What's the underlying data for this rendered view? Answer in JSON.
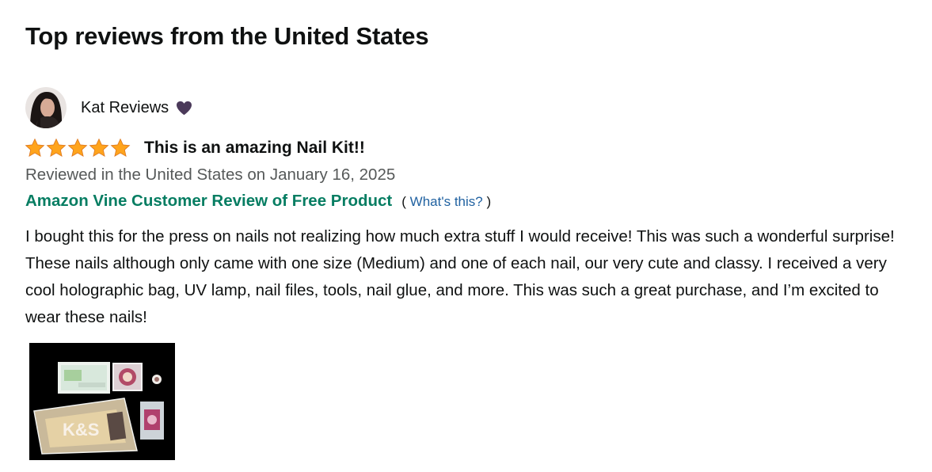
{
  "section": {
    "title": "Top reviews from the United States"
  },
  "review": {
    "profile_name": "Kat Reviews",
    "badge_icon": "purple-heart-icon",
    "rating": {
      "value": 5,
      "max": 5,
      "color": "#ffa41c"
    },
    "title": "This is an amazing Nail Kit!!",
    "date": "Reviewed in the United States on January 16, 2025",
    "vine": {
      "label": "Amazon Vine Customer Review of Free Product",
      "open_paren": "(",
      "link": "What's this?",
      "close_paren": ")",
      "color": "#067d62"
    },
    "body": "I bought this for the press on nails not realizing how much extra stuff I would receive! This was such a wonderful surprise! These nails although only came with one size (Medium) and one of each nail, our very cute and classy. I received a very cool holographic bag, UV lamp, nail files, tools, nail glue, and more. This was such a great purchase, and I’m excited to wear these nails!",
    "image_overlay_text": "K&S"
  }
}
